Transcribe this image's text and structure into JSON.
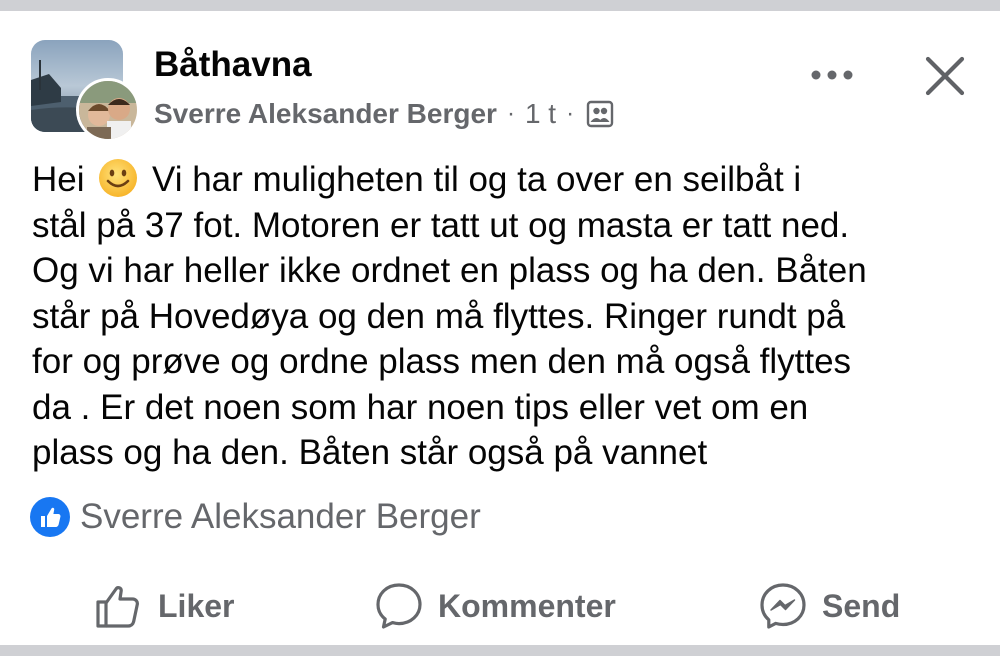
{
  "post": {
    "group_name": "Båthavna",
    "author": "Sverre Aleksander Berger",
    "time": "1 t",
    "separator": "·",
    "body_before_emoji": "Hei",
    "body_after_emoji": "Vi har muligheten til og ta over en seilbåt i\nstål på 37 fot. Motoren er tatt ut og  masta er tatt ned.\nOg vi har heller ikke ordnet en plass og ha den. Båten\nstår på Hovedøya og den må flyttes. Ringer rundt på\nfor og prøve og ordne plass men den må også flyttes\nda . Er det noen som har noen tips eller vet om en\nplass og ha den. Båten står også på vannet",
    "reactions": {
      "icon": "like-icon",
      "reactors": "Sverre Aleksander Berger"
    }
  },
  "actions": {
    "like_label": "Liker",
    "comment_label": "Kommenter",
    "send_label": "Send"
  },
  "icons": {
    "more": "more-horizontal-icon",
    "close": "close-icon",
    "audience": "group-members-icon",
    "emoji": "smiley-emoji-icon"
  },
  "colors": {
    "text_primary": "#050505",
    "text_secondary": "#65676b",
    "like_blue": "#1877f2",
    "separator_band": "#cfd0d4"
  }
}
